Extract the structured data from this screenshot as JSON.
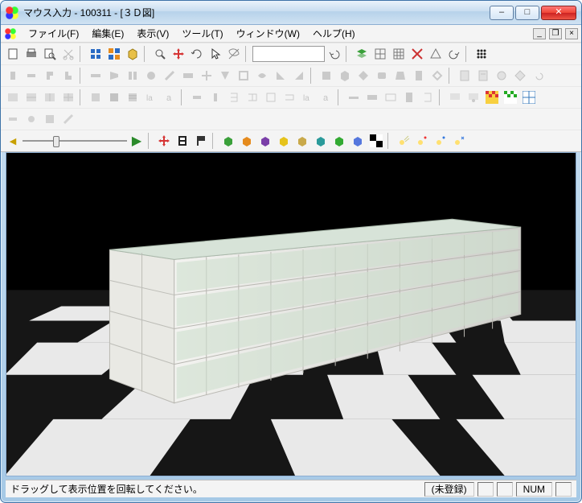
{
  "window": {
    "title": "マウス入力 - 100311 - [３Ｄ図]"
  },
  "mdi_buttons": {
    "min": "_",
    "restore": "❐",
    "close": "×"
  },
  "win_buttons": {
    "min": "–",
    "max": "□",
    "close": "✕"
  },
  "menu": {
    "file": "ファイル(F)",
    "edit": "編集(E)",
    "view": "表示(V)",
    "tool": "ツール(T)",
    "window": "ウィンドウ(W)",
    "help": "ヘルプ(H)"
  },
  "toolbar_row1": {
    "combo_value": "",
    "icons": [
      "new",
      "print",
      "preview",
      "cut",
      "snap-grid",
      "snap-panel",
      "snap-face",
      "magnifier",
      "pan",
      "rotate3d",
      "select",
      "hide",
      "undo",
      "redo",
      "layers",
      "grid-a",
      "grid-b",
      "m-cross",
      "triangle",
      "grid-dots"
    ]
  },
  "status": {
    "hint": "ドラッグして表示位置を回転してください。",
    "reg": "(未登録)",
    "num": "NUM"
  }
}
